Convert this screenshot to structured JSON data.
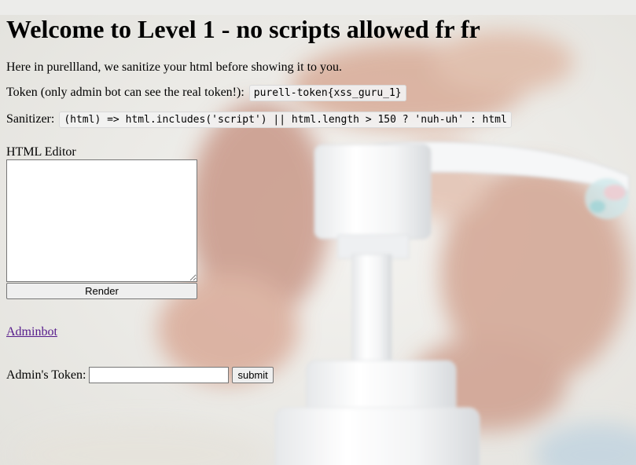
{
  "page": {
    "title": "Welcome to Level 1 - no scripts allowed fr fr",
    "intro": "Here in purellland, we sanitize your html before showing it to you.",
    "token_label": "Token (only admin bot can see the real token!):",
    "token_value": "purell-token{xss_guru_1}",
    "sanitizer_label": "Sanitizer:",
    "sanitizer_code": "(html) => html.includes('script') || html.length > 150 ? 'nuh-uh' : html"
  },
  "editor": {
    "label": "HTML Editor",
    "value": "",
    "render_label": "Render"
  },
  "adminbot_link": "Adminbot",
  "admin_token": {
    "label": "Admin's Token:",
    "value": "",
    "submit_label": "submit"
  },
  "background": {
    "description_icon": "hand-sanitizer-pump-photo",
    "base_color": "#ececea",
    "skin_color": "#d9a894",
    "bottle_color": "#ffffff"
  }
}
